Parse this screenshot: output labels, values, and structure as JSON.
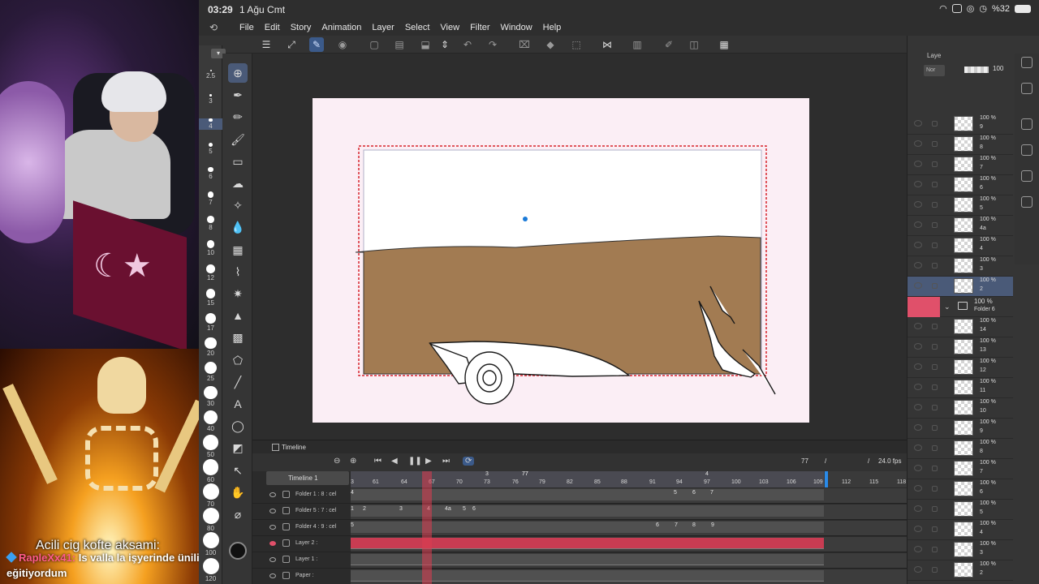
{
  "stream": {
    "caption": "Acili cig kofte aksami:",
    "chat_user": "RapleXx41:",
    "chat_message": " Is valla la işyerinde ünili geliyordu ben eğitiyordum"
  },
  "status_bar": {
    "time": "03:29",
    "date": "1 Ağu Cmt",
    "battery": "%32"
  },
  "menu": {
    "items": [
      "File",
      "Edit",
      "Story",
      "Animation",
      "Layer",
      "Select",
      "View",
      "Filter",
      "Window",
      "Help"
    ]
  },
  "brush_sizes": [
    "2.5",
    "3",
    "4",
    "5",
    "6",
    "7",
    "8",
    "10",
    "12",
    "15",
    "17",
    "20",
    "25",
    "30",
    "40",
    "50",
    "60",
    "70",
    "80",
    "100",
    "120"
  ],
  "tools": [
    "move-icon",
    "pen-icon",
    "pencil-icon",
    "brush-icon",
    "eraser-icon",
    "airbrush-icon",
    "decoration-icon",
    "blend-icon",
    "grid-icon",
    "lasso-icon",
    "magic-wand-icon",
    "fill-icon",
    "gradient-icon",
    "figure-icon",
    "line-icon",
    "text-icon",
    "balloon-icon",
    "shape-icon",
    "object-select-icon",
    "hand-icon",
    "eyedropper-icon"
  ],
  "layers_panel": {
    "tab_label": "Laye",
    "blend_mode": "Nor",
    "opacity": "100",
    "layers": [
      {
        "pct": "100 %",
        "name": "9"
      },
      {
        "pct": "100 %",
        "name": "8"
      },
      {
        "pct": "100 %",
        "name": "7"
      },
      {
        "pct": "100 %",
        "name": "6"
      },
      {
        "pct": "100 %",
        "name": "5"
      },
      {
        "pct": "100 %",
        "name": "4a"
      },
      {
        "pct": "100 %",
        "name": "4"
      },
      {
        "pct": "100 %",
        "name": "3"
      },
      {
        "pct": "100 %",
        "name": "2",
        "selected": true
      },
      {
        "pct": "100 %",
        "name": "Folder 6",
        "folder": true
      },
      {
        "pct": "100 %",
        "name": "14"
      },
      {
        "pct": "100 %",
        "name": "13"
      },
      {
        "pct": "100 %",
        "name": "12"
      },
      {
        "pct": "100 %",
        "name": "11"
      },
      {
        "pct": "100 %",
        "name": "10"
      },
      {
        "pct": "100 %",
        "name": "9"
      },
      {
        "pct": "100 %",
        "name": "8"
      },
      {
        "pct": "100 %",
        "name": "7"
      },
      {
        "pct": "100 %",
        "name": "6"
      },
      {
        "pct": "100 %",
        "name": "5"
      },
      {
        "pct": "100 %",
        "name": "4"
      },
      {
        "pct": "100 %",
        "name": "3"
      },
      {
        "pct": "100 %",
        "name": "2"
      }
    ]
  },
  "timeline": {
    "title": "Timeline",
    "name": "Timeline 1",
    "current_frame": "77",
    "slash": "/",
    "fps": "24.0 fps",
    "ruler_top": [
      "3",
      "4"
    ],
    "ruler": [
      "3",
      "61",
      "64",
      "67",
      "70",
      "73",
      "76",
      "77",
      "79",
      "82",
      "85",
      "88",
      "91",
      "94",
      "97",
      "100",
      "103",
      "106",
      "109",
      "112",
      "115",
      "118"
    ],
    "tracks": [
      {
        "name": "Folder 1 : 8 : cel",
        "cells": [
          "4",
          "5",
          "6",
          "7"
        ]
      },
      {
        "name": "Folder 5 : 7 : cel",
        "cells": [
          "1",
          "2",
          "3",
          "4",
          "4a",
          "5",
          "6"
        ]
      },
      {
        "name": "Folder 4 : 9 : cel",
        "cells": [
          "5",
          "6",
          "7",
          "8",
          "9"
        ]
      },
      {
        "name": "Layer 2 :",
        "cells": []
      },
      {
        "name": "Layer 1 :",
        "cells": []
      },
      {
        "name": "Paper :",
        "cells": []
      }
    ]
  },
  "colors": {
    "accent_blue": "#3b5a8a",
    "playhead_red": "#dc3c50",
    "layer_red": "#e0506a",
    "ground_brown": "#a27b52",
    "paper_pink": "#fbeef5"
  }
}
